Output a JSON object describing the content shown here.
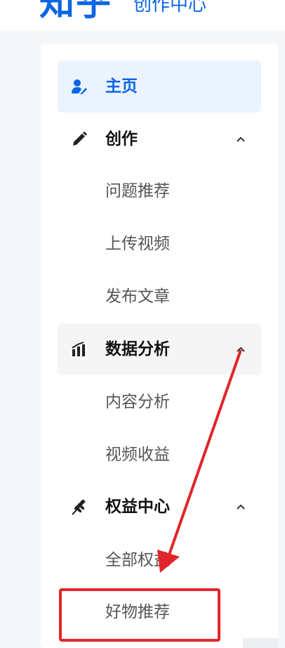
{
  "header": {
    "logo": "知乎",
    "title": "创作中心"
  },
  "sidebar": {
    "home": {
      "label": "主页",
      "icon": "user-pen-icon"
    },
    "create": {
      "label": "创作",
      "icon": "pencil-icon",
      "children": [
        "问题推荐",
        "上传视频",
        "发布文章"
      ]
    },
    "analytics": {
      "label": "数据分析",
      "icon": "bar-chart-icon",
      "children": [
        "内容分析",
        "视频收益"
      ]
    },
    "benefits": {
      "label": "权益中心",
      "icon": "wheat-icon",
      "children": [
        "全部权益",
        "好物推荐"
      ]
    }
  },
  "colors": {
    "brand": "#0a66e4",
    "annotation": "#e0262a"
  }
}
